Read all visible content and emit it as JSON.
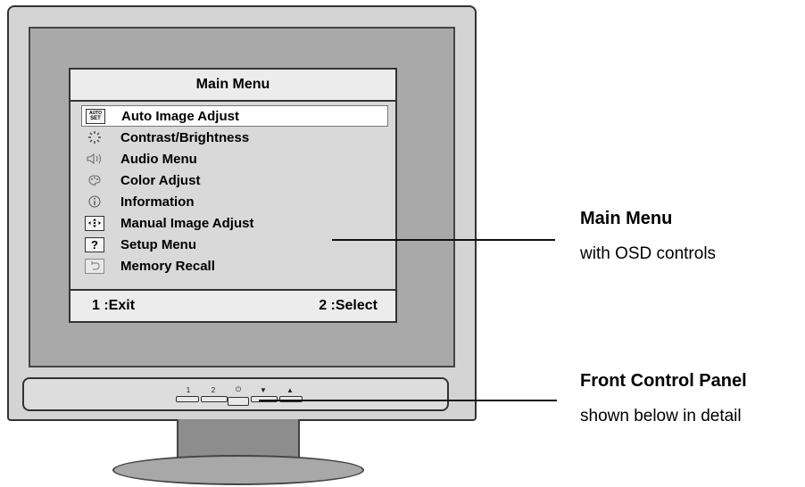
{
  "osd": {
    "title": "Main Menu",
    "items": [
      {
        "icon": "auto-set-icon",
        "icon_text_top": "AUTO",
        "icon_text_bottom": "SET",
        "label": "Auto Image Adjust",
        "selected": true
      },
      {
        "icon": "brightness-icon",
        "label": "Contrast/Brightness"
      },
      {
        "icon": "speaker-icon",
        "label": "Audio Menu"
      },
      {
        "icon": "palette-icon",
        "label": "Color Adjust"
      },
      {
        "icon": "info-icon",
        "label": "Information"
      },
      {
        "icon": "move-arrows-icon",
        "label": "Manual Image Adjust"
      },
      {
        "icon": "question-icon",
        "icon_text": "?",
        "label": "Setup Menu"
      },
      {
        "icon": "undo-icon",
        "label": "Memory Recall"
      }
    ],
    "footer": {
      "exit": "1 :Exit",
      "select": "2 :Select"
    }
  },
  "panel": {
    "buttons": [
      {
        "icon": "button-1-icon",
        "glyph": "1"
      },
      {
        "icon": "button-2-icon",
        "glyph": "2"
      },
      {
        "icon": "power-icon",
        "glyph": "⏻"
      },
      {
        "icon": "down-triangle-icon",
        "glyph": "▼"
      },
      {
        "icon": "up-triangle-icon",
        "glyph": "▲"
      }
    ]
  },
  "callouts": {
    "main_menu": {
      "title": "Main Menu",
      "subtitle": "with OSD controls"
    },
    "front_panel": {
      "title": "Front Control Panel",
      "subtitle": "shown below in detail"
    }
  }
}
